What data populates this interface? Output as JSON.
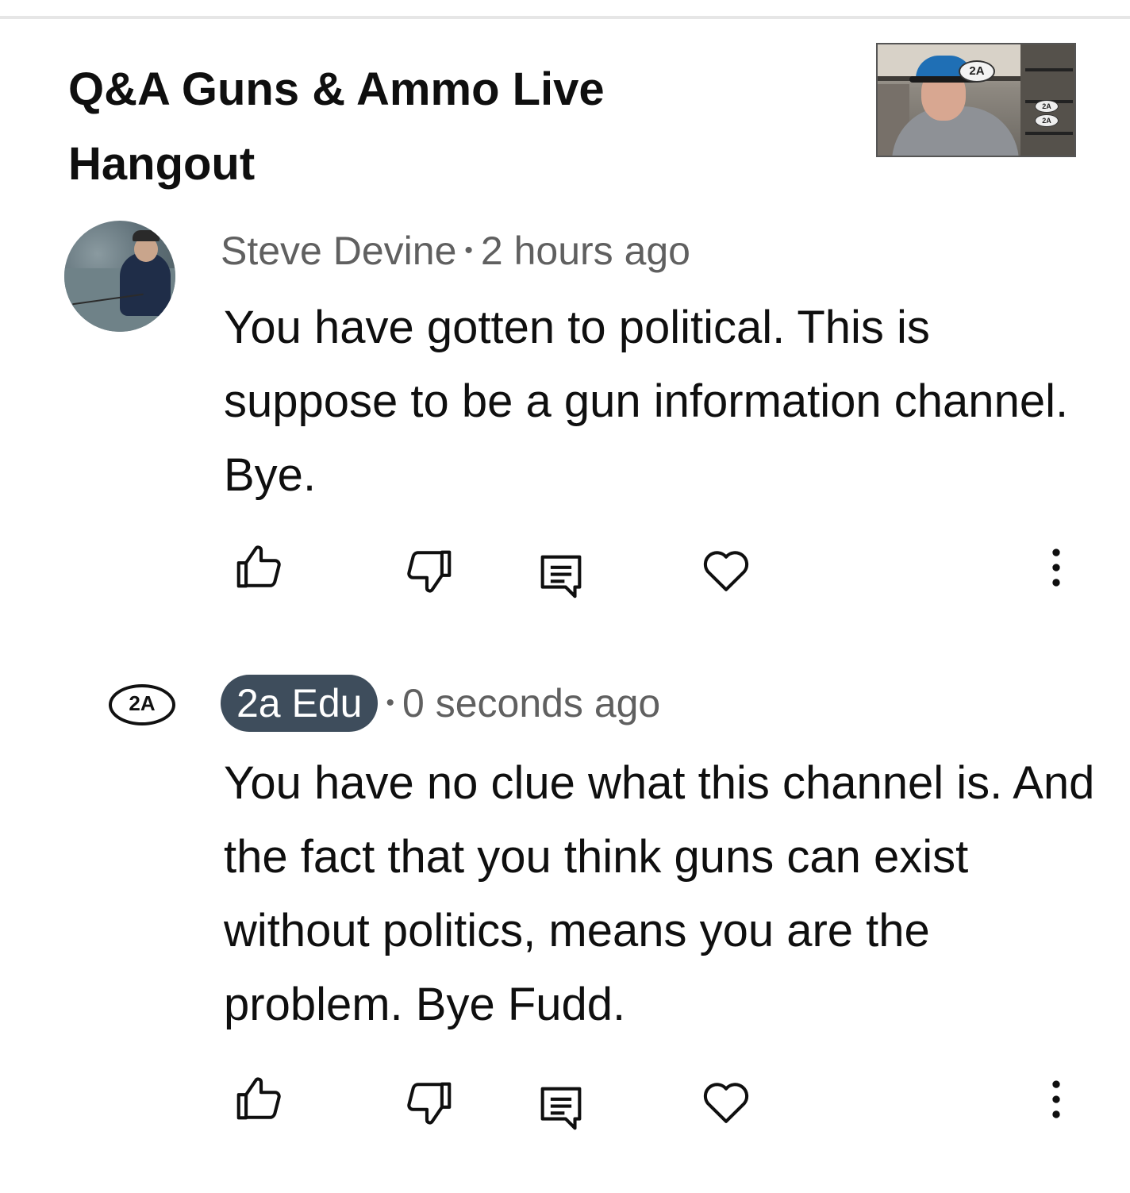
{
  "video": {
    "title": "Q&A Guns & Ammo Live Hangout",
    "thumbnail_badge": "2A"
  },
  "comments": [
    {
      "author": "Steve Devine",
      "separator": "•",
      "time": "2 hours ago",
      "text": "You have gotten to political. This is suppose to be a gun information channel. Bye.",
      "avatar_icon": "fisherman-avatar"
    },
    {
      "author": "2a Edu",
      "separator": "•",
      "time": "0 seconds ago",
      "text": "You have no clue what this channel is. And the fact that you think guns can exist without politics,  means you are the problem.  Bye Fudd.",
      "avatar_text": "2A",
      "avatar_icon": "2a-logo-avatar",
      "is_creator": true
    }
  ],
  "actions": [
    "thumbs-up-icon",
    "thumbs-down-icon",
    "reply-icon",
    "heart-icon",
    "more-vert-icon"
  ],
  "colors": {
    "text_primary": "#0f0f0f",
    "text_secondary": "#606060",
    "creator_pill": "#3e4d5c"
  }
}
